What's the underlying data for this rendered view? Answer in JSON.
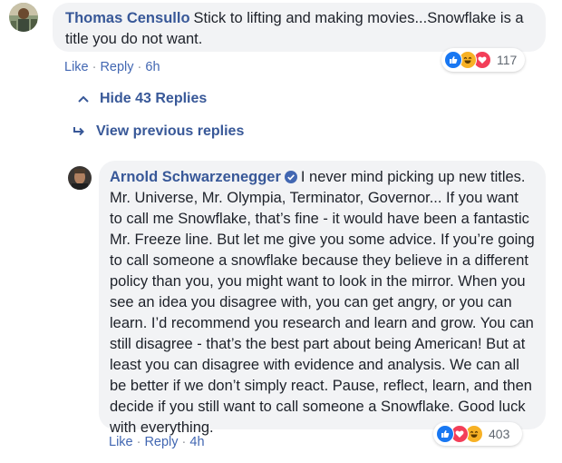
{
  "comment1": {
    "author": "Thomas Censullo",
    "text": "Stick to lifting and making movies...Snowflake is a title you do not want.",
    "actions": {
      "like": "Like",
      "reply": "Reply",
      "time": "6h",
      "sep": "·"
    },
    "reaction_count": "117",
    "reactions": [
      "like-icon",
      "haha-icon",
      "love-icon"
    ]
  },
  "replies_toggle": {
    "hide_label": "Hide 43 Replies",
    "previous_label": "View previous replies"
  },
  "comment2": {
    "author": "Arnold Schwarzenegger",
    "verified": true,
    "text": "I never mind picking up new titles. Mr. Universe, Mr. Olympia, Terminator, Governor... If you want to call me Snowflake, that’s fine - it would have been a fantastic Mr. Freeze line. But let me give you some advice. If you’re going to call someone a snowflake because they believe in a different policy than you, you might want to look in the mirror. When you see an idea you disagree with, you can get angry, or you can learn. I’d recommend you research and learn and grow. You can still disagree - that’s the best part about being American! But at least you can disagree with evidence and analysis. We can all be better if we don’t simply react. Pause, reflect, learn, and then decide if you still want to call someone a Snowflake. Good luck with everything.",
    "actions": {
      "like": "Like",
      "reply": "Reply",
      "time": "4h",
      "sep": "·"
    },
    "reaction_count": "403",
    "reactions": [
      "like-icon",
      "love-icon",
      "haha-icon"
    ]
  },
  "colors": {
    "link": "#385898",
    "bubble": "#f2f3f5",
    "like": "#1877f2",
    "love": "#f33e58",
    "haha": "#f7b125"
  }
}
